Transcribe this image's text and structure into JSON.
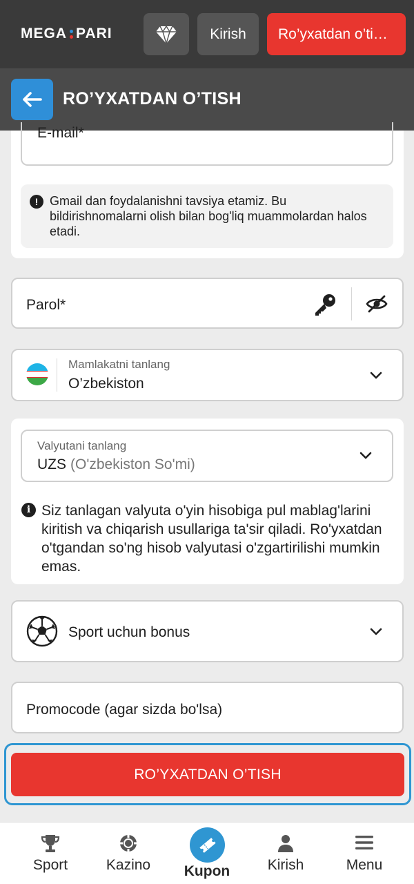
{
  "header": {
    "logo_left": "MEGA",
    "logo_right": "PARI",
    "login_label": "Kirish",
    "register_label": "Ro’yxatdan o’ti…"
  },
  "titlebar": {
    "title": "RO’YXATDAN O’TISH"
  },
  "form": {
    "email_placeholder": "E-mail*",
    "email_note": "Gmail dan foydalanishni tavsiya etamiz. Bu bildirishnomalarni olish bilan bog'liq muammolardan halos etadi.",
    "password_placeholder": "Parol*",
    "country_label": "Mamlakatni tanlang",
    "country_value": "O’zbekiston",
    "currency_label": "Valyutani tanlang",
    "currency_code": "UZS",
    "currency_name": "(O'zbekiston So'mi)",
    "currency_note": "Siz tanlagan valyuta o'yin hisobiga pul mablag'larini kiritish va chiqarish usullariga ta'sir qiladi. Ro'yxatdan o'tgandan so'ng hisob valyutasi o'zgartirilishi mumkin emas.",
    "bonus_value": "Sport uchun bonus",
    "promo_placeholder": "Promocode (agar sizda bo'lsa)",
    "submit_label": "RO’YXATDAN O’TISH"
  },
  "bottom_nav": {
    "items": [
      {
        "label": "Sport",
        "icon": "trophy-icon"
      },
      {
        "label": "Kazino",
        "icon": "casino-chip-icon"
      },
      {
        "label": "Kupon",
        "icon": "ticket-icon",
        "active": true
      },
      {
        "label": "Kirish",
        "icon": "user-icon"
      },
      {
        "label": "Menu",
        "icon": "hamburger-menu-icon"
      }
    ]
  },
  "colors": {
    "header_bg": "#3a3a3a",
    "accent_red": "#e8362f",
    "accent_blue": "#2f8fd8"
  }
}
